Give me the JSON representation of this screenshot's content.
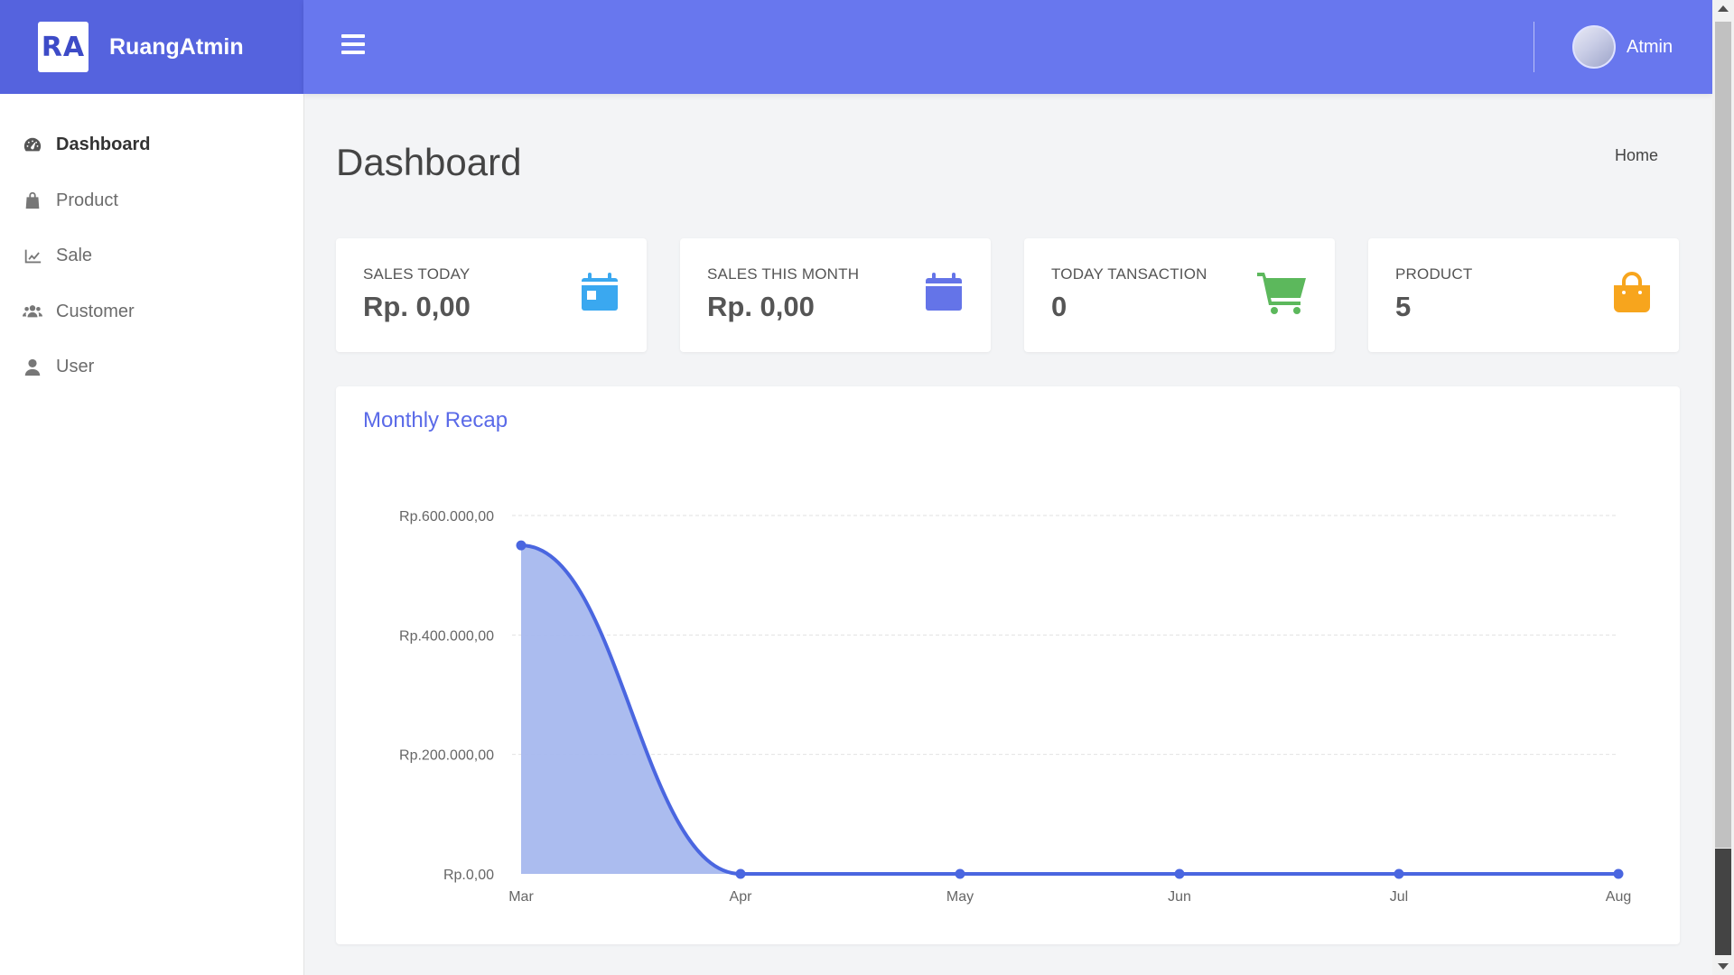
{
  "brand": {
    "logo_text": "RA",
    "name": "RuangAtmin"
  },
  "sidebar": {
    "items": [
      {
        "label": "Dashboard",
        "icon": "tachometer-icon",
        "active": true
      },
      {
        "label": "Product",
        "icon": "shopping-bag-icon"
      },
      {
        "label": "Sale",
        "icon": "line-chart-icon"
      },
      {
        "label": "Customer",
        "icon": "users-icon"
      },
      {
        "label": "User",
        "icon": "user-icon"
      }
    ]
  },
  "topbar": {
    "user_name": "Atmin"
  },
  "page": {
    "title": "Dashboard",
    "breadcrumb": "Home"
  },
  "cards": [
    {
      "label": "SALES TODAY",
      "value": "Rp. 0,00",
      "icon": "calendar-day-icon",
      "color": "#3aa8f0"
    },
    {
      "label": "SALES THIS MONTH",
      "value": "Rp. 0,00",
      "icon": "calendar-icon",
      "color": "#6474e8"
    },
    {
      "label": "TODAY TANSACTION",
      "value": "0",
      "icon": "shopping-cart-icon",
      "color": "#5cb85c"
    },
    {
      "label": "PRODUCT",
      "value": "5",
      "icon": "shopping-bag-icon",
      "color": "#f7a51d"
    }
  ],
  "chart_data": {
    "type": "area",
    "title": "Monthly Recap",
    "categories": [
      "Mar",
      "Apr",
      "May",
      "Jun",
      "Jul",
      "Aug"
    ],
    "series": [
      {
        "values": [
          550000,
          0,
          0,
          0,
          0,
          0
        ]
      }
    ],
    "ylim": [
      0,
      600000
    ],
    "yticks": [
      0,
      200000,
      400000,
      600000
    ],
    "ytick_labels": [
      "Rp.0,00",
      "Rp.200.000,00",
      "Rp.400.000,00",
      "Rp.600.000,00"
    ],
    "grid": true,
    "colors": {
      "line": "#4a66e0",
      "fill": "#a6b8ee"
    }
  }
}
